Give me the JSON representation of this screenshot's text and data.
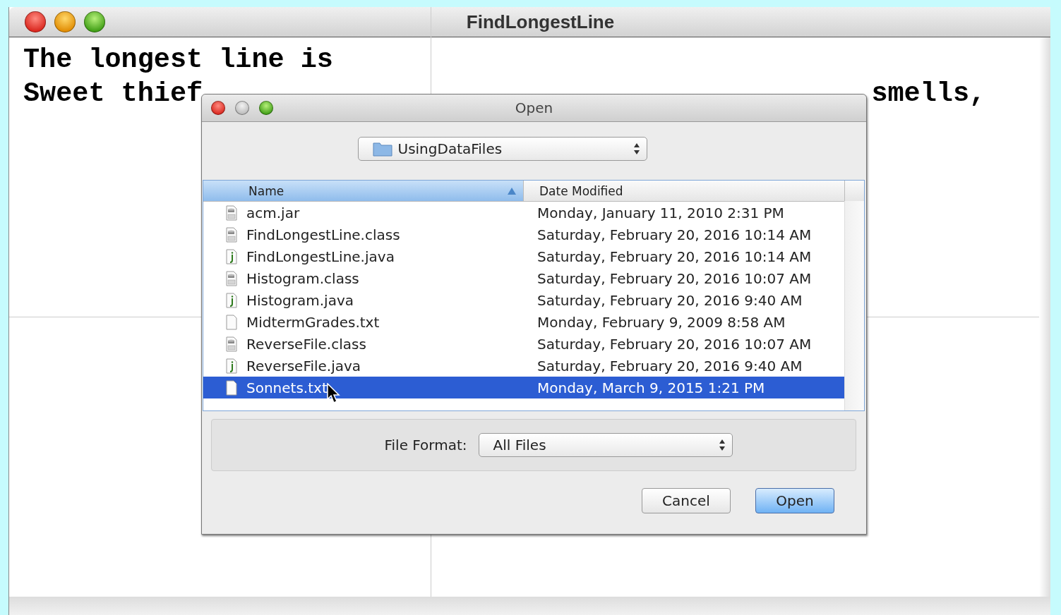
{
  "window": {
    "title": "FindLongestLine",
    "window_buttons": [
      {
        "kind": "close",
        "disabled": false
      },
      {
        "kind": "minimize",
        "disabled": false
      },
      {
        "kind": "zoom",
        "disabled": false
      }
    ]
  },
  "content": {
    "lines": [
      [
        "The longest line is"
      ],
      [
        "Sweet thief",
        "smells,"
      ]
    ]
  },
  "dialog": {
    "title": "Open",
    "window_buttons": [
      {
        "kind": "close",
        "disabled": false
      },
      {
        "kind": "minimize",
        "disabled": true
      },
      {
        "kind": "zoom",
        "disabled": false
      }
    ],
    "location": {
      "value": "UsingDataFiles"
    },
    "table": {
      "columns": [
        {
          "label": "Name",
          "sorted": true
        },
        {
          "label": "Date Modified",
          "sorted": false
        }
      ],
      "rows": [
        {
          "kind": "jar",
          "name": "acm.jar",
          "date": "Monday, January 11, 2010 2:31 PM",
          "selected": false
        },
        {
          "kind": "class",
          "name": "FindLongestLine.class",
          "date": "Saturday, February 20, 2016 10:14 AM",
          "selected": false
        },
        {
          "kind": "java",
          "name": "FindLongestLine.java",
          "date": "Saturday, February 20, 2016 10:14 AM",
          "selected": false
        },
        {
          "kind": "class",
          "name": "Histogram.class",
          "date": "Saturday, February 20, 2016 10:07 AM",
          "selected": false
        },
        {
          "kind": "java",
          "name": "Histogram.java",
          "date": "Saturday, February 20, 2016 9:40 AM",
          "selected": false
        },
        {
          "kind": "text",
          "name": "MidtermGrades.txt",
          "date": "Monday, February 9, 2009 8:58 AM",
          "selected": false
        },
        {
          "kind": "class",
          "name": "ReverseFile.class",
          "date": "Saturday, February 20, 2016 10:07 AM",
          "selected": false
        },
        {
          "kind": "java",
          "name": "ReverseFile.java",
          "date": "Saturday, February 20, 2016 9:40 AM",
          "selected": false
        },
        {
          "kind": "text",
          "name": "Sonnets.txt",
          "date": "Monday, March 9, 2015 1:21 PM",
          "selected": true
        }
      ]
    },
    "file_format": {
      "label": "File Format:",
      "value": "All Files"
    },
    "buttons": [
      {
        "label": "Cancel",
        "default": false
      },
      {
        "label": "Open",
        "default": true
      }
    ]
  }
}
